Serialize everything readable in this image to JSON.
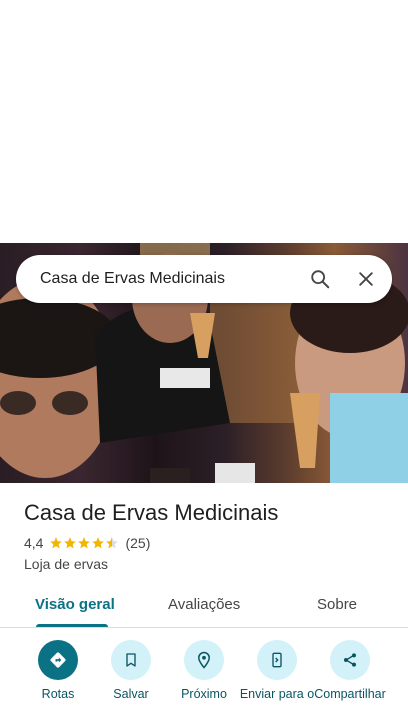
{
  "search": {
    "query": "Casa de Ervas Medicinais",
    "search_icon": "search-icon",
    "close_icon": "close-icon"
  },
  "place": {
    "name": "Casa de Ervas Medicinais",
    "rating": "4,4",
    "stars": 4.4,
    "reviews_count": "(25)",
    "category": "Loja de ervas"
  },
  "tabs": [
    {
      "label": "Visão geral",
      "active": true
    },
    {
      "label": "Avaliações",
      "active": false
    },
    {
      "label": "Sobre",
      "active": false
    }
  ],
  "actions": [
    {
      "label": "Rotas",
      "icon": "directions-icon"
    },
    {
      "label": "Salvar",
      "icon": "bookmark-icon"
    },
    {
      "label": "Próximo",
      "icon": "nearby-icon"
    },
    {
      "label": "Enviar para o",
      "icon": "send-to-phone-icon"
    },
    {
      "label": "Compartilhar",
      "icon": "share-icon"
    }
  ],
  "colors": {
    "accent": "#0b7285",
    "action_bg": "#d2f1f8",
    "star": "#f4b400"
  }
}
